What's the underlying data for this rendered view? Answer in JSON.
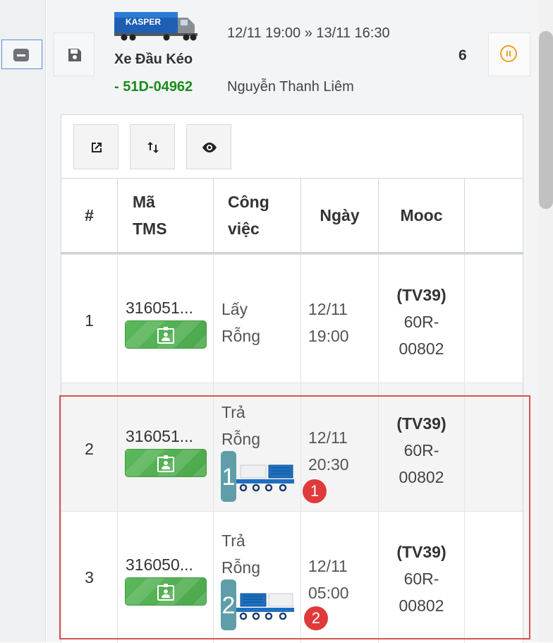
{
  "vehicle": {
    "logo_text": "KASPER",
    "type": "Xe Đầu Kéo",
    "plate": "- 51D-04962",
    "time_range": "12/11 19:00 » 13/11 16:30",
    "driver": "Nguyễn Thanh Liêm",
    "count": "6"
  },
  "table": {
    "headers": [
      "#",
      "Mã TMS",
      "Công việc",
      "Ngày",
      "Mooc",
      ""
    ],
    "rows": [
      {
        "idx": "1",
        "tms": "316051...",
        "job": "Lấy Rỗng",
        "date": "12/11 19:00",
        "mooc_code": "(TV39)",
        "mooc_plate": "60R-00802"
      },
      {
        "idx": "2",
        "tms": "316051...",
        "job": "Trả Rỗng",
        "container_num": "1",
        "marker": "1",
        "date": "12/11 20:30",
        "mooc_code": "(TV39)",
        "mooc_plate": "60R-00802"
      },
      {
        "idx": "3",
        "tms": "316050...",
        "job": "Trả Rỗng",
        "container_num": "2",
        "marker": "2",
        "date": "12/11 05:00",
        "mooc_code": "(TV39)",
        "mooc_plate": "60R-00802"
      }
    ]
  },
  "colors": {
    "plate_green": "#1a8c1a",
    "pause_orange": "#f0a020",
    "badge_green": "#5cb85c",
    "highlight_red": "#d9534f",
    "marker_red": "#e03a3a",
    "container_teal": "#5f9ea8"
  },
  "icons": {
    "collapse": "minus-square-icon",
    "save": "floppy-disk-icon",
    "pause": "pause-circle-icon",
    "open": "open-in-new-icon",
    "sort": "sort-arrows-icon",
    "view": "eye-icon",
    "badge": "id-badge-icon"
  }
}
